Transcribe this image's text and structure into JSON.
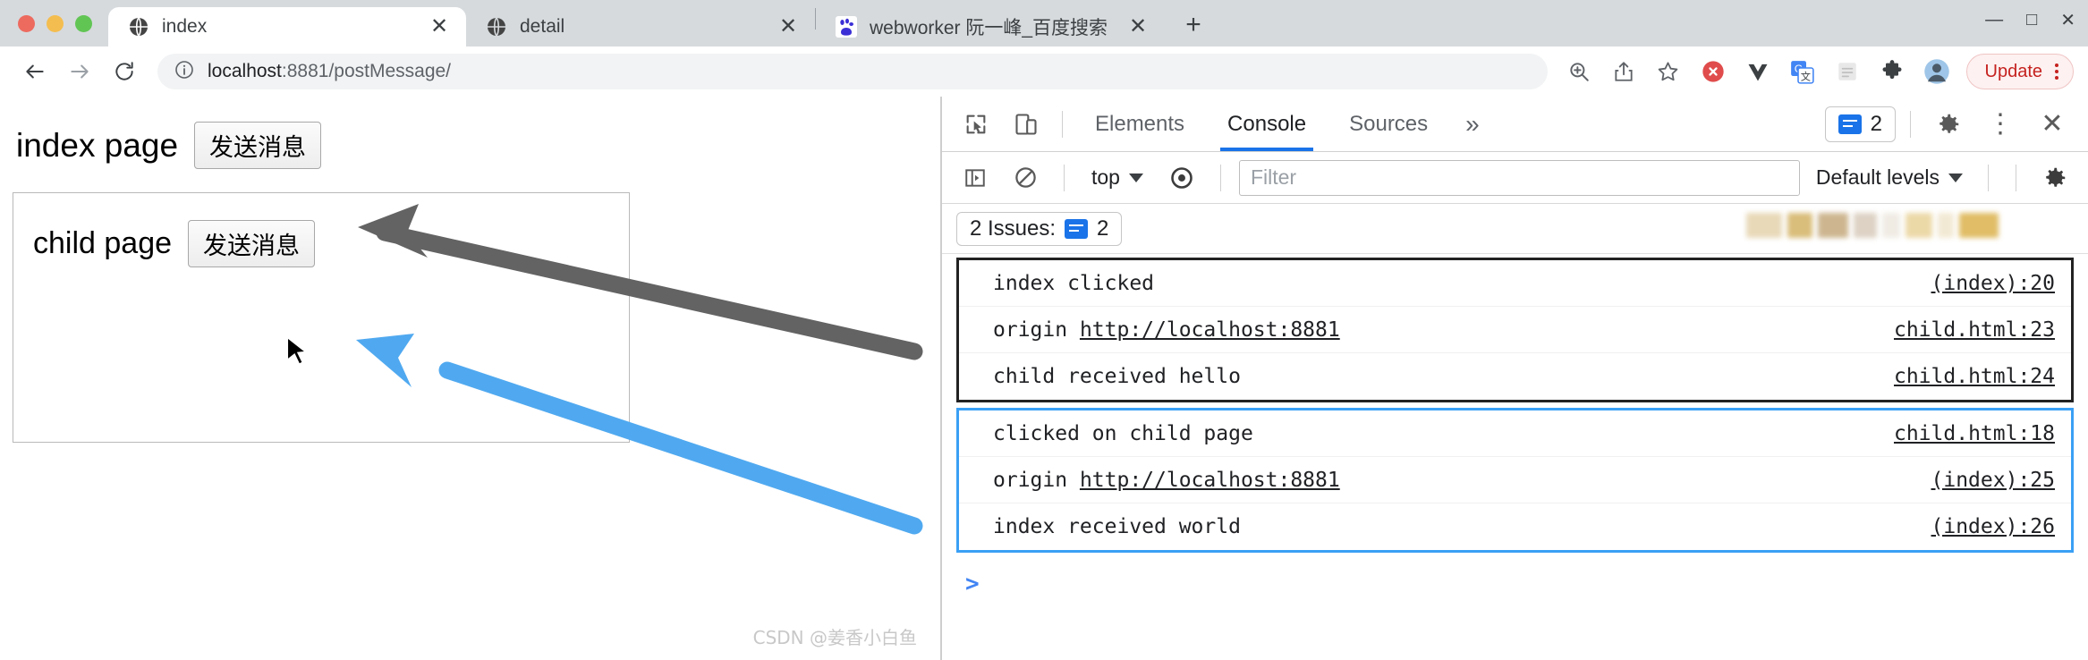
{
  "window": {
    "traffic_lights": [
      "close",
      "minimize",
      "maximize"
    ],
    "minimize_label": "—",
    "maximize_label": "□",
    "close_label": "✕"
  },
  "tabs": [
    {
      "title": "index",
      "favicon": "globe-icon",
      "close_label": "✕",
      "active": true
    },
    {
      "title": "detail",
      "favicon": "globe-icon",
      "close_label": "✕",
      "active": false
    },
    {
      "title": "webworker 阮一峰_百度搜索",
      "favicon": "baidu-icon",
      "close_label": "✕",
      "active": false
    }
  ],
  "new_tab_label": "+",
  "toolbar": {
    "back_label": "←",
    "forward_label": "→",
    "reload_label": "⟳",
    "site_info_icon": "info-circle-icon",
    "url_host": "localhost",
    "url_path": ":8881/postMessage/",
    "url_full": "localhost:8881/postMessage/",
    "icons": [
      {
        "name": "zoom-search-icon",
        "glyph": "⌕"
      },
      {
        "name": "share-icon",
        "glyph": "⇪"
      },
      {
        "name": "bookmark-star-icon",
        "glyph": "☆"
      },
      {
        "name": "adblock-icon",
        "glyph": "●"
      },
      {
        "name": "vue-devtools-icon",
        "glyph": "V"
      },
      {
        "name": "google-translate-icon",
        "glyph": "G"
      },
      {
        "name": "disabled-extension-icon",
        "glyph": "▩"
      },
      {
        "name": "extensions-puzzle-icon",
        "glyph": "🧩"
      },
      {
        "name": "profile-avatar-icon",
        "glyph": "◓"
      }
    ],
    "update_label": "Update",
    "menu_label": "⋮"
  },
  "page": {
    "index_title": "index page",
    "index_button": "发送消息",
    "child_title": "child page",
    "child_button": "发送消息",
    "watermark": "CSDN @姜香小白鱼",
    "gray_arrow_color": "#636363",
    "blue_arrow_color": "#50a9f0"
  },
  "devtools": {
    "inspect_icon": "inspect-element-icon",
    "device_icon": "device-toolbar-icon",
    "tabs": [
      {
        "label": "Elements",
        "active": false
      },
      {
        "label": "Console",
        "active": true
      },
      {
        "label": "Sources",
        "active": false
      }
    ],
    "more_tabs_label": "»",
    "issue_count_badge": "2",
    "settings_label": "⚙",
    "more_options_label": "⋮",
    "close_label": "✕",
    "filter_bar": {
      "sidebar_toggle_icon": "console-sidebar-icon",
      "clear_console_icon": "clear-console-icon",
      "context_label": "top",
      "eye_icon": "live-expression-icon",
      "filter_placeholder": "Filter",
      "filter_value": "",
      "levels_label": "Default levels",
      "settings_icon": "console-settings-icon"
    },
    "issues_bar": {
      "label": "2 Issues:",
      "count": "2",
      "icon": "issues-message-icon"
    },
    "log_groups": [
      {
        "border_color": "#222222",
        "rows": [
          {
            "message": "index clicked",
            "link": "",
            "source": "(index):20"
          },
          {
            "message": "origin ",
            "link": "http://localhost:8881",
            "source": "child.html:23"
          },
          {
            "message": "child received hello",
            "link": "",
            "source": "child.html:24"
          }
        ]
      },
      {
        "border_color": "#3aa0f5",
        "rows": [
          {
            "message": "clicked on child page",
            "link": "",
            "source": "child.html:18"
          },
          {
            "message": "origin ",
            "link": "http://localhost:8881",
            "source": "(index):25"
          },
          {
            "message": "index received world",
            "link": "",
            "source": "(index):26"
          }
        ]
      }
    ],
    "prompt_symbol": ">"
  }
}
